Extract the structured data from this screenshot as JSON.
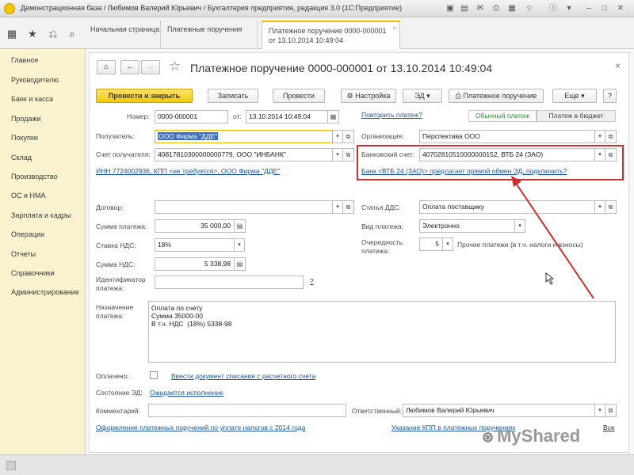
{
  "window": {
    "title": "Демонстрационная база / Любимов Валерий Юрьевич / Бухгалтерия предприятия, редакция 3.0  (1С:Предприятие)"
  },
  "tabs": [
    {
      "label": "Начальная страница"
    },
    {
      "label": "Платежные поручения"
    },
    {
      "label": "Платежное поручение 0000-000001",
      "label2": "от 13.10.2014 10:49:04",
      "close": "×"
    }
  ],
  "menu": [
    "Главное",
    "Руководителю",
    "Банк и касса",
    "Продажи",
    "Покупки",
    "Склад",
    "Производство",
    "ОС и НМА",
    "Зарплата и кадры",
    "Операции",
    "Отчеты",
    "Справочники",
    "Администрирование"
  ],
  "form": {
    "title": "Платежное поручение 0000-000001 от 13.10.2014 10:49:04",
    "toolbar": {
      "post_close": "Провести и закрыть",
      "write": "Записать",
      "post": "Провести",
      "settings": "Настройка",
      "ed": "ЭД",
      "print_pp": "Платежное поручение",
      "more": "Еще",
      "help": "?"
    },
    "number_label": "Номер:",
    "number": "0000-000001",
    "date_label": "от:",
    "date": "13.10.2014 10:49:04",
    "repeat_link": "Повторить платеж?",
    "toggle_regular": "Обычный платеж",
    "toggle_budget": "Платеж в бюджет",
    "recipient_label": "Получатель:",
    "recipient": "ООО Фирма \"ДДЕ\"",
    "org_label": "Организация:",
    "org": "Перспектива ООО",
    "recipient_account_label": "Счет получателя:",
    "recipient_account": "40817810300000000779, ООО \"ИНБАНК\"",
    "bank_account_label": "Банковский счет:",
    "bank_account": "40702810510000000152, ВТБ 24 (ЗАО)",
    "inn_link": "ИНН 7724002936, КПП <не требуется>, ООО Фирма \"ДДЕ\"",
    "bank_link": "Банк <ВТБ 24 (ЗАО)> предлагает прямой обмен ЭД, подключить?",
    "contract_label": "Договор:",
    "contract": "",
    "dds_label": "Статья ДДС:",
    "dds": "Оплата поставщику",
    "sum_label": "Сумма платежа:",
    "sum": "35 000,00",
    "payment_type_label": "Вид платежа:",
    "payment_type": "Электронно",
    "vat_rate_label": "Ставка НДС:",
    "vat_rate": "18%",
    "queue_label": "Очередность платежа:",
    "queue_label_1": "Очередность",
    "queue_label_2": "платежа:",
    "queue": "5",
    "queue_note": "Прочие платежи (в т.ч. налоги и взносы)",
    "vat_sum_label": "Сумма НДС:",
    "vat_sum": "5 338,98",
    "ident_label_1": "Идентификатор",
    "ident_label_2": "платежа:",
    "ident": "",
    "ident_help": "?",
    "purpose_label_1": "Назначение",
    "purpose_label_2": "платежа:",
    "purpose": "Оплата по счету\nСумма 35000-00\nВ т.ч. НДС  (18%) 5338-98",
    "paid_label": "Оплачено:",
    "paid_link": "Ввести документ списания с расчетного счета",
    "ed_state_label": "Состояние ЭД:",
    "ed_state_link": "Ожидается исполнение",
    "comment_label": "Комментарий:",
    "comment": "",
    "responsible_label": "Ответственный:",
    "responsible": "Любимов Валерий Юрьевич",
    "footer_link_1": "Оформление платежных поручений по уплате налогов с 2014 года",
    "footer_link_2": "Указание КПП в платежных поручениях",
    "footer_all": "Все"
  },
  "watermark": "MyShared",
  "colors": {
    "accent_yellow": "#f1c811",
    "menu_bg": "#fbf3cf",
    "link": "#1a56a8",
    "annotation_red": "#c9302c"
  }
}
